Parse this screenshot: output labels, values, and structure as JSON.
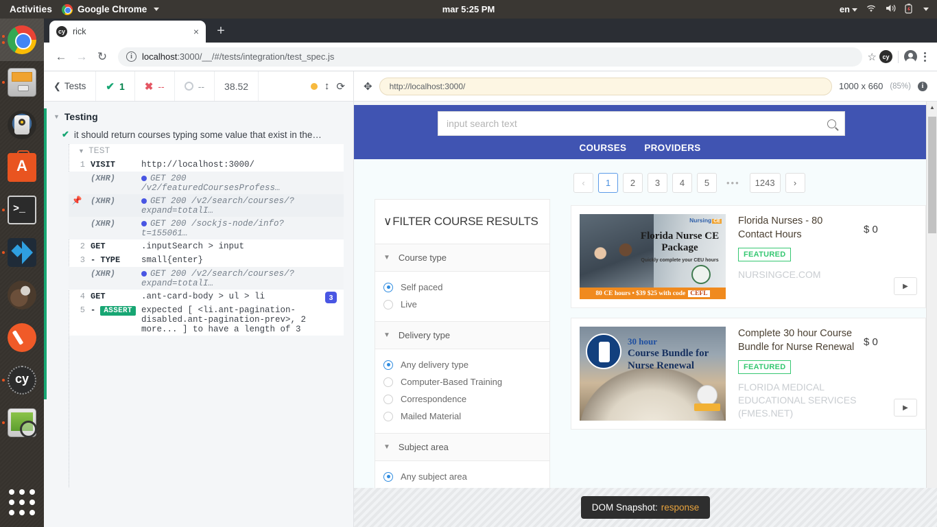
{
  "desktop": {
    "activities": "Activities",
    "app_menu": "Google Chrome",
    "clock": "mar  5:25 PM",
    "keyboard": "en",
    "dock_items": [
      {
        "name": "google-chrome",
        "running": true,
        "active": true
      },
      {
        "name": "files",
        "running": true,
        "active": false
      },
      {
        "name": "rhythmbox",
        "running": false,
        "active": false
      },
      {
        "name": "ubuntu-software",
        "running": false,
        "active": false
      },
      {
        "name": "terminal",
        "running": true,
        "active": false
      },
      {
        "name": "visual-studio-code",
        "running": true,
        "active": false
      },
      {
        "name": "otter-browser",
        "running": false,
        "active": false
      },
      {
        "name": "gimp",
        "running": false,
        "active": false
      },
      {
        "name": "cypress",
        "running": true,
        "active": false
      },
      {
        "name": "screenshot",
        "running": true,
        "active": false
      }
    ]
  },
  "browser": {
    "tab": {
      "title": "rick",
      "favicon_label": "cy",
      "close_label": "×"
    },
    "new_tab_label": "+",
    "nav": {
      "back": "←",
      "forward": "→",
      "reload": "↻"
    },
    "omnibox": {
      "host": "localhost",
      "rest": ":3000/__/#/tests/integration/test_spec.js",
      "full": "localhost:3000/__/#/tests/integration/test_spec.js",
      "site_info": "i"
    },
    "toolbar": {
      "bookmark": "☆",
      "extension": "cy",
      "menu": "kebab"
    }
  },
  "reporter": {
    "back_label": "Tests",
    "stats": {
      "passed": "1",
      "failed": "--",
      "pending": "--",
      "duration": "38.52"
    },
    "suite": "Testing",
    "test_title": "it should return courses typing some value that exist in the…",
    "hooks_label": "TEST",
    "commands": [
      {
        "num": "1",
        "name": "VISIT",
        "message": "http://localhost:3000/",
        "type": "cmd"
      },
      {
        "num": "",
        "name": "(XHR)",
        "message": "GET 200 /v2/featuredCoursesProfess…",
        "type": "xhr"
      },
      {
        "num": "",
        "name": "(XHR)",
        "message": "GET 200 /v2/search/courses/?expand=totalI…",
        "type": "xhr",
        "pinned": true
      },
      {
        "num": "",
        "name": "(XHR)",
        "message": "GET 200 /sockjs-node/info?t=155061…",
        "type": "xhr"
      },
      {
        "num": "2",
        "name": "GET",
        "message": ".inputSearch > input",
        "type": "cmd"
      },
      {
        "num": "3",
        "name": "- TYPE",
        "message": "small{enter}",
        "type": "cmd"
      },
      {
        "num": "",
        "name": "(XHR)",
        "message": "GET 200 /v2/search/courses/?expand=totalI…",
        "type": "xhr"
      },
      {
        "num": "4",
        "name": "GET",
        "message": ".ant-card-body > ul > li",
        "type": "cmd",
        "badge": "3"
      },
      {
        "num": "5",
        "name": "- ASSERT",
        "message": "expected [ <li.ant-pagination-disabled.ant-pagination-prev>, 2 more... ] to have a length of 3",
        "type": "assert",
        "tag": "ASSERT"
      }
    ]
  },
  "aut": {
    "url": "http://localhost:3000/",
    "viewport": "1000 x 660",
    "scale": "(85%)"
  },
  "snapshot": {
    "label": "DOM Snapshot:",
    "value": "response"
  },
  "app": {
    "search_placeholder": "input search text",
    "nav": [
      "COURSES",
      "PROVIDERS"
    ],
    "filters": {
      "title": "FILTER COURSE RESULTS",
      "groups": [
        {
          "label": "Course type",
          "options": [
            {
              "label": "Self paced",
              "selected": true
            },
            {
              "label": "Live",
              "selected": false
            }
          ]
        },
        {
          "label": "Delivery type",
          "options": [
            {
              "label": "Any delivery type",
              "selected": true
            },
            {
              "label": "Computer-Based Training",
              "selected": false
            },
            {
              "label": "Correspondence",
              "selected": false
            },
            {
              "label": "Mailed Material",
              "selected": false
            }
          ]
        },
        {
          "label": "Subject area",
          "options": [
            {
              "label": "Any subject area",
              "selected": true
            }
          ]
        }
      ]
    },
    "pagination": {
      "prev": "‹",
      "next": "›",
      "ellipsis": "•••",
      "pages": [
        "1",
        "2",
        "3",
        "4",
        "5"
      ],
      "last": "1243",
      "current": "1"
    },
    "courses": [
      {
        "title": "Florida Nurses - 80 Contact Hours",
        "badge": "FEATURED",
        "provider": "NURSINGCE.COM",
        "price": "$ 0",
        "go": "▶",
        "art": {
          "watermark": "Nursing",
          "watermark_badge": "CE",
          "headline": "Florida Nurse CE Package",
          "subline": "Quickly complete your CEU hours",
          "promo": "80 CE hours • $39 $25 with code",
          "promo_code": "CEFL"
        }
      },
      {
        "title": "Complete 30 hour Course Bundle for Nurse Renewal",
        "badge": "FEATURED",
        "provider": "FLORIDA MEDICAL EDUCATIONAL SERVICES (FMES.NET)",
        "price": "$ 0",
        "go": "▶",
        "art": {
          "line1": "30 hour",
          "line2": "Course Bundle for Nurse Renewal"
        }
      }
    ]
  },
  "colors": {
    "app_header": "#4054b2",
    "pass_green": "#17a673",
    "fail_red": "#e45663",
    "xhr_blue": "#4956e3",
    "featured_green": "#35c771",
    "snapshot_accent": "#e8a33d"
  }
}
